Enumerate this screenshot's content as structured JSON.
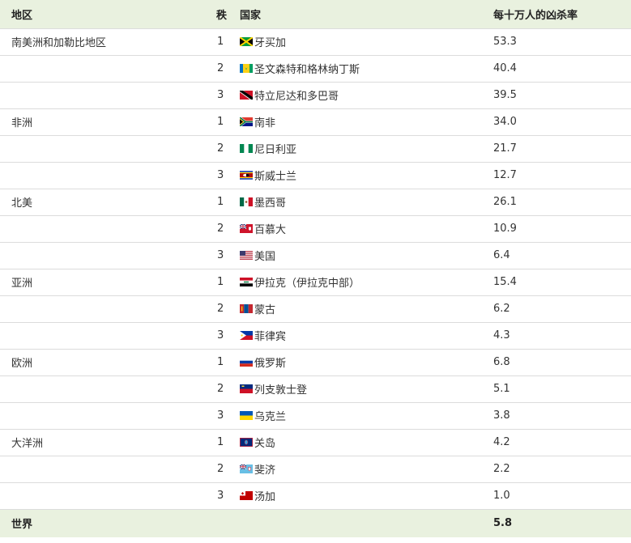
{
  "table": {
    "headers": {
      "region": "地区",
      "rank": "秩",
      "country": "国家",
      "rate": "每十万人的凶杀率"
    },
    "rows": [
      {
        "region": "南美洲和加勒比地区",
        "rank": "1",
        "country": "牙买加",
        "rate": "53.3",
        "flag": "flag-jamaica"
      },
      {
        "region": "",
        "rank": "2",
        "country": "圣文森特和格林纳丁斯",
        "rate": "40.4",
        "flag": "flag-saint-vincent"
      },
      {
        "region": "",
        "rank": "3",
        "country": "特立尼达和多巴哥",
        "rate": "39.5",
        "flag": "flag-trinidad"
      },
      {
        "region": "非洲",
        "rank": "1",
        "country": "南非",
        "rate": "34.0",
        "flag": "flag-south-africa"
      },
      {
        "region": "",
        "rank": "2",
        "country": "尼日利亚",
        "rate": "21.7",
        "flag": "flag-nigeria"
      },
      {
        "region": "",
        "rank": "3",
        "country": "斯威士兰",
        "rate": "12.7",
        "flag": "flag-eswatini"
      },
      {
        "region": "北美",
        "rank": "1",
        "country": "墨西哥",
        "rate": "26.1",
        "flag": "flag-mexico"
      },
      {
        "region": "",
        "rank": "2",
        "country": "百慕大",
        "rate": "10.9",
        "flag": "flag-bermuda"
      },
      {
        "region": "",
        "rank": "3",
        "country": "美国",
        "rate": "6.4",
        "flag": "flag-usa"
      },
      {
        "region": "亚洲",
        "rank": "1",
        "country": "伊拉克（伊拉克中部）",
        "rate": "15.4",
        "flag": "flag-iraq"
      },
      {
        "region": "",
        "rank": "2",
        "country": "蒙古",
        "rate": "6.2",
        "flag": "flag-mongolia"
      },
      {
        "region": "",
        "rank": "3",
        "country": "菲律宾",
        "rate": "4.3",
        "flag": "flag-philippines"
      },
      {
        "region": "欧洲",
        "rank": "1",
        "country": "俄罗斯",
        "rate": "6.8",
        "flag": "flag-russia"
      },
      {
        "region": "",
        "rank": "2",
        "country": "列支敦士登",
        "rate": "5.1",
        "flag": "flag-liechtenstein"
      },
      {
        "region": "",
        "rank": "3",
        "country": "乌克兰",
        "rate": "3.8",
        "flag": "flag-ukraine"
      },
      {
        "region": "大洋洲",
        "rank": "1",
        "country": "关岛",
        "rate": "4.2",
        "flag": "flag-guam"
      },
      {
        "region": "",
        "rank": "2",
        "country": "斐济",
        "rate": "2.2",
        "flag": "flag-fiji"
      },
      {
        "region": "",
        "rank": "3",
        "country": "汤加",
        "rate": "1.0",
        "flag": "flag-tonga"
      }
    ],
    "footer": {
      "label": "世界",
      "rate": "5.8"
    }
  }
}
